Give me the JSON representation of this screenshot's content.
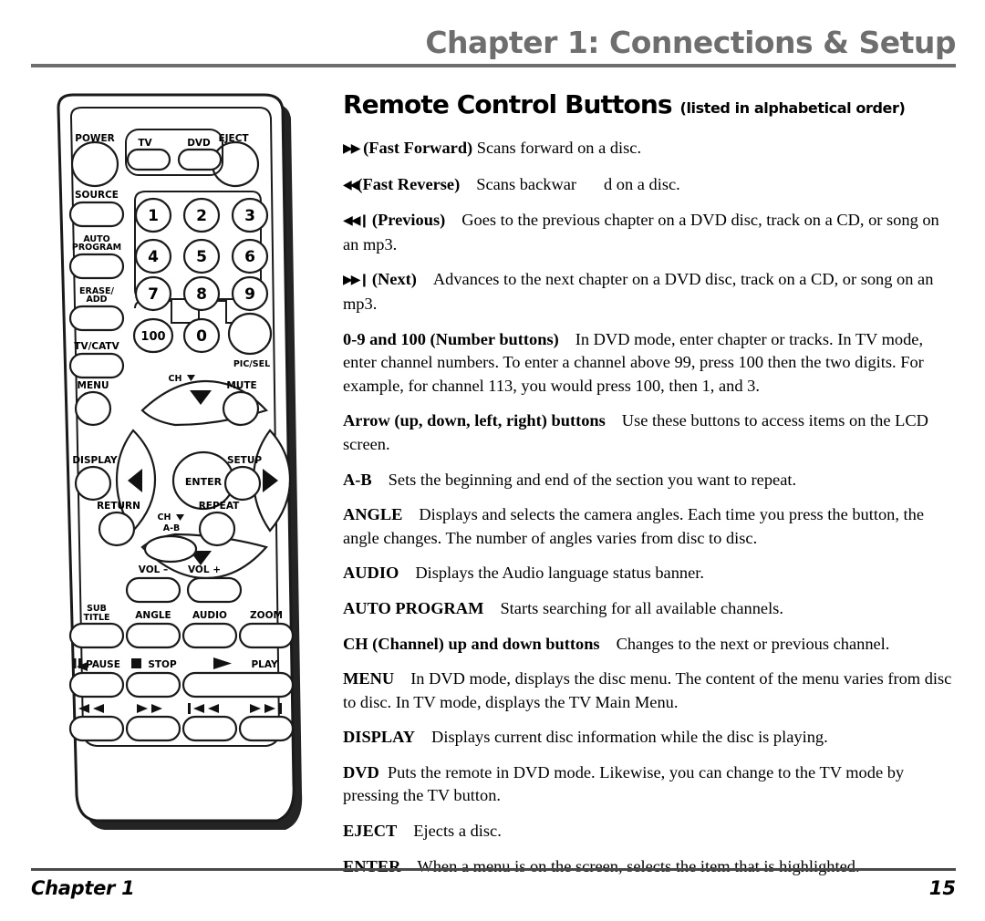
{
  "header": {
    "chapter_title": "Chapter 1: Connections & Setup",
    "rule_color": "#6e6e6e"
  },
  "footer": {
    "left": "Chapter 1",
    "page_number": "15"
  },
  "main": {
    "title": "Remote Control Buttons",
    "title_suffix": "(listed in alphabetical order)",
    "entries": [
      {
        "glyph": "▶▶",
        "term": "(Fast Forward)",
        "desc": "Scans forward on a disc."
      },
      {
        "glyph": "◀◀",
        "term": "(Fast Reverse)",
        "desc_a": "Scans backwar",
        "desc_b": "d on a disc."
      },
      {
        "glyph": "◀◀❙",
        "term": "(Previous)",
        "desc": "Goes to the previous chapter on a DVD disc, track on a CD, or song on an mp3."
      },
      {
        "glyph": "▶▶❙",
        "term": "(Next)",
        "desc": "Advances to the next chapter on a DVD disc, track on a CD, or song on an mp3."
      },
      {
        "term": "0-9 and 100 (Number buttons)",
        "desc": "In DVD mode, enter chapter or tracks. In TV mode, enter channel numbers. To enter a channel above 99, press 100 then the two digits. For example, for channel 113, you would press 100, then 1, and 3."
      },
      {
        "term": "Arrow (up, down, left, right) buttons",
        "desc": "Use these buttons to access items on the LCD screen."
      },
      {
        "term": "A-B",
        "desc": "Sets the beginning and end of the section you want to repeat."
      },
      {
        "term": "ANGLE",
        "desc": "Displays and selects the camera angles. Each time you press the button, the angle changes. The number of angles varies from disc to disc."
      },
      {
        "term": "AUDIO",
        "desc": "Displays the Audio language status banner."
      },
      {
        "term": "AUTO PROGRAM",
        "desc": "Starts searching for all available channels."
      },
      {
        "term": "CH (Channel) up and down buttons",
        "desc": "Changes to the next or previous channel."
      },
      {
        "term": "MENU",
        "desc": "In DVD mode, displays the disc menu. The content of the menu varies from disc to disc. In TV mode, displays the TV Main Menu."
      },
      {
        "term": "DISPLAY",
        "desc": "Displays current disc information while the disc is playing."
      },
      {
        "term": "DVD",
        "desc": "Puts the remote in DVD mode. Likewise, you can change to the TV mode by pressing the TV button."
      },
      {
        "term": "EJECT",
        "desc": "Ejects a disc."
      },
      {
        "term": "ENTER",
        "desc": "When a menu is on the screen, selects the item that is highlighted."
      }
    ]
  },
  "remote": {
    "labels": {
      "power": "POWER",
      "eject": "EJECT",
      "tv": "TV",
      "dvd": "DVD",
      "source": "SOURCE",
      "auto_program_1": "AUTO",
      "auto_program_2": "PROGRAM",
      "erase_1": "ERASE/",
      "erase_2": "ADD",
      "tv_catv": "TV/CATV",
      "pic_sel": "PIC/SEL",
      "menu": "MENU",
      "mute": "MUTE",
      "ch_up": "CH",
      "ch_down": "CH",
      "enter": "ENTER",
      "display": "DISPLAY",
      "setup": "SETUP",
      "return": "RETURN",
      "repeat": "REPEAT",
      "a_b": "A-B",
      "vol_minus": "VOL –",
      "vol_plus": "VOL +",
      "sub_1": "SUB",
      "sub_2": "TITLE",
      "angle": "ANGLE",
      "audio": "AUDIO",
      "zoom": "ZOOM",
      "pause": "PAUSE",
      "stop": "STOP",
      "play": "PLAY"
    },
    "numbers": [
      "1",
      "2",
      "3",
      "4",
      "5",
      "6",
      "7",
      "8",
      "9",
      "100",
      "0"
    ]
  }
}
